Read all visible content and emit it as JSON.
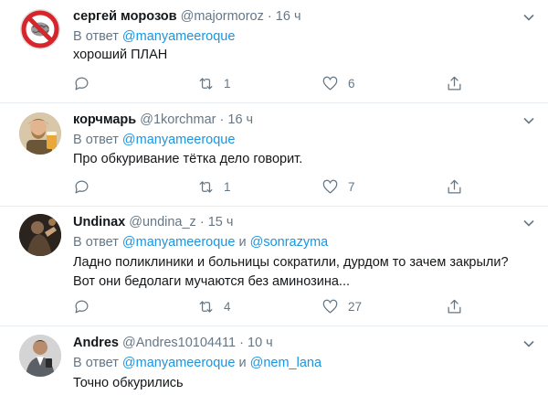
{
  "reply_prefix": "В ответ",
  "conjunction": "и",
  "dot": "·",
  "colors": {
    "accent": "#1b95e0",
    "secondary": "#657786",
    "border": "#e6ecf0"
  },
  "tweets": [
    {
      "name": "сергей морозов",
      "handle": "@majormoroz",
      "time": "16 ч",
      "mentions": [
        "@manyameeroque"
      ],
      "text_lines": [
        "хороший ПЛАН"
      ],
      "reply_count": "",
      "retweet_count": "1",
      "like_count": "6",
      "avatar": "no-brain-sign"
    },
    {
      "name": "корчмарь",
      "handle": "@1korchmar",
      "time": "16 ч",
      "mentions": [
        "@manyameeroque"
      ],
      "text_lines": [
        "Про обкуривание тётка дело говорит."
      ],
      "reply_count": "",
      "retweet_count": "1",
      "like_count": "7",
      "avatar": "man-with-beer"
    },
    {
      "name": "Undinax",
      "handle": "@undina_z",
      "time": "15 ч",
      "mentions": [
        "@manyameeroque",
        "@sonrazyma"
      ],
      "text_lines": [
        "Ладно поликлиники и больницы сократили, дурдом то зачем закрыли?",
        "Вот они бедолаги мучаются без аминозина..."
      ],
      "reply_count": "",
      "retweet_count": "4",
      "like_count": "27",
      "avatar": "dark-photo"
    },
    {
      "name": "Andres",
      "handle": "@Andres10104411",
      "time": "10 ч",
      "mentions": [
        "@manyameeroque",
        "@nem_lana"
      ],
      "text_lines": [
        "Точно обкурились"
      ],
      "avatar": "man-in-suit"
    }
  ]
}
